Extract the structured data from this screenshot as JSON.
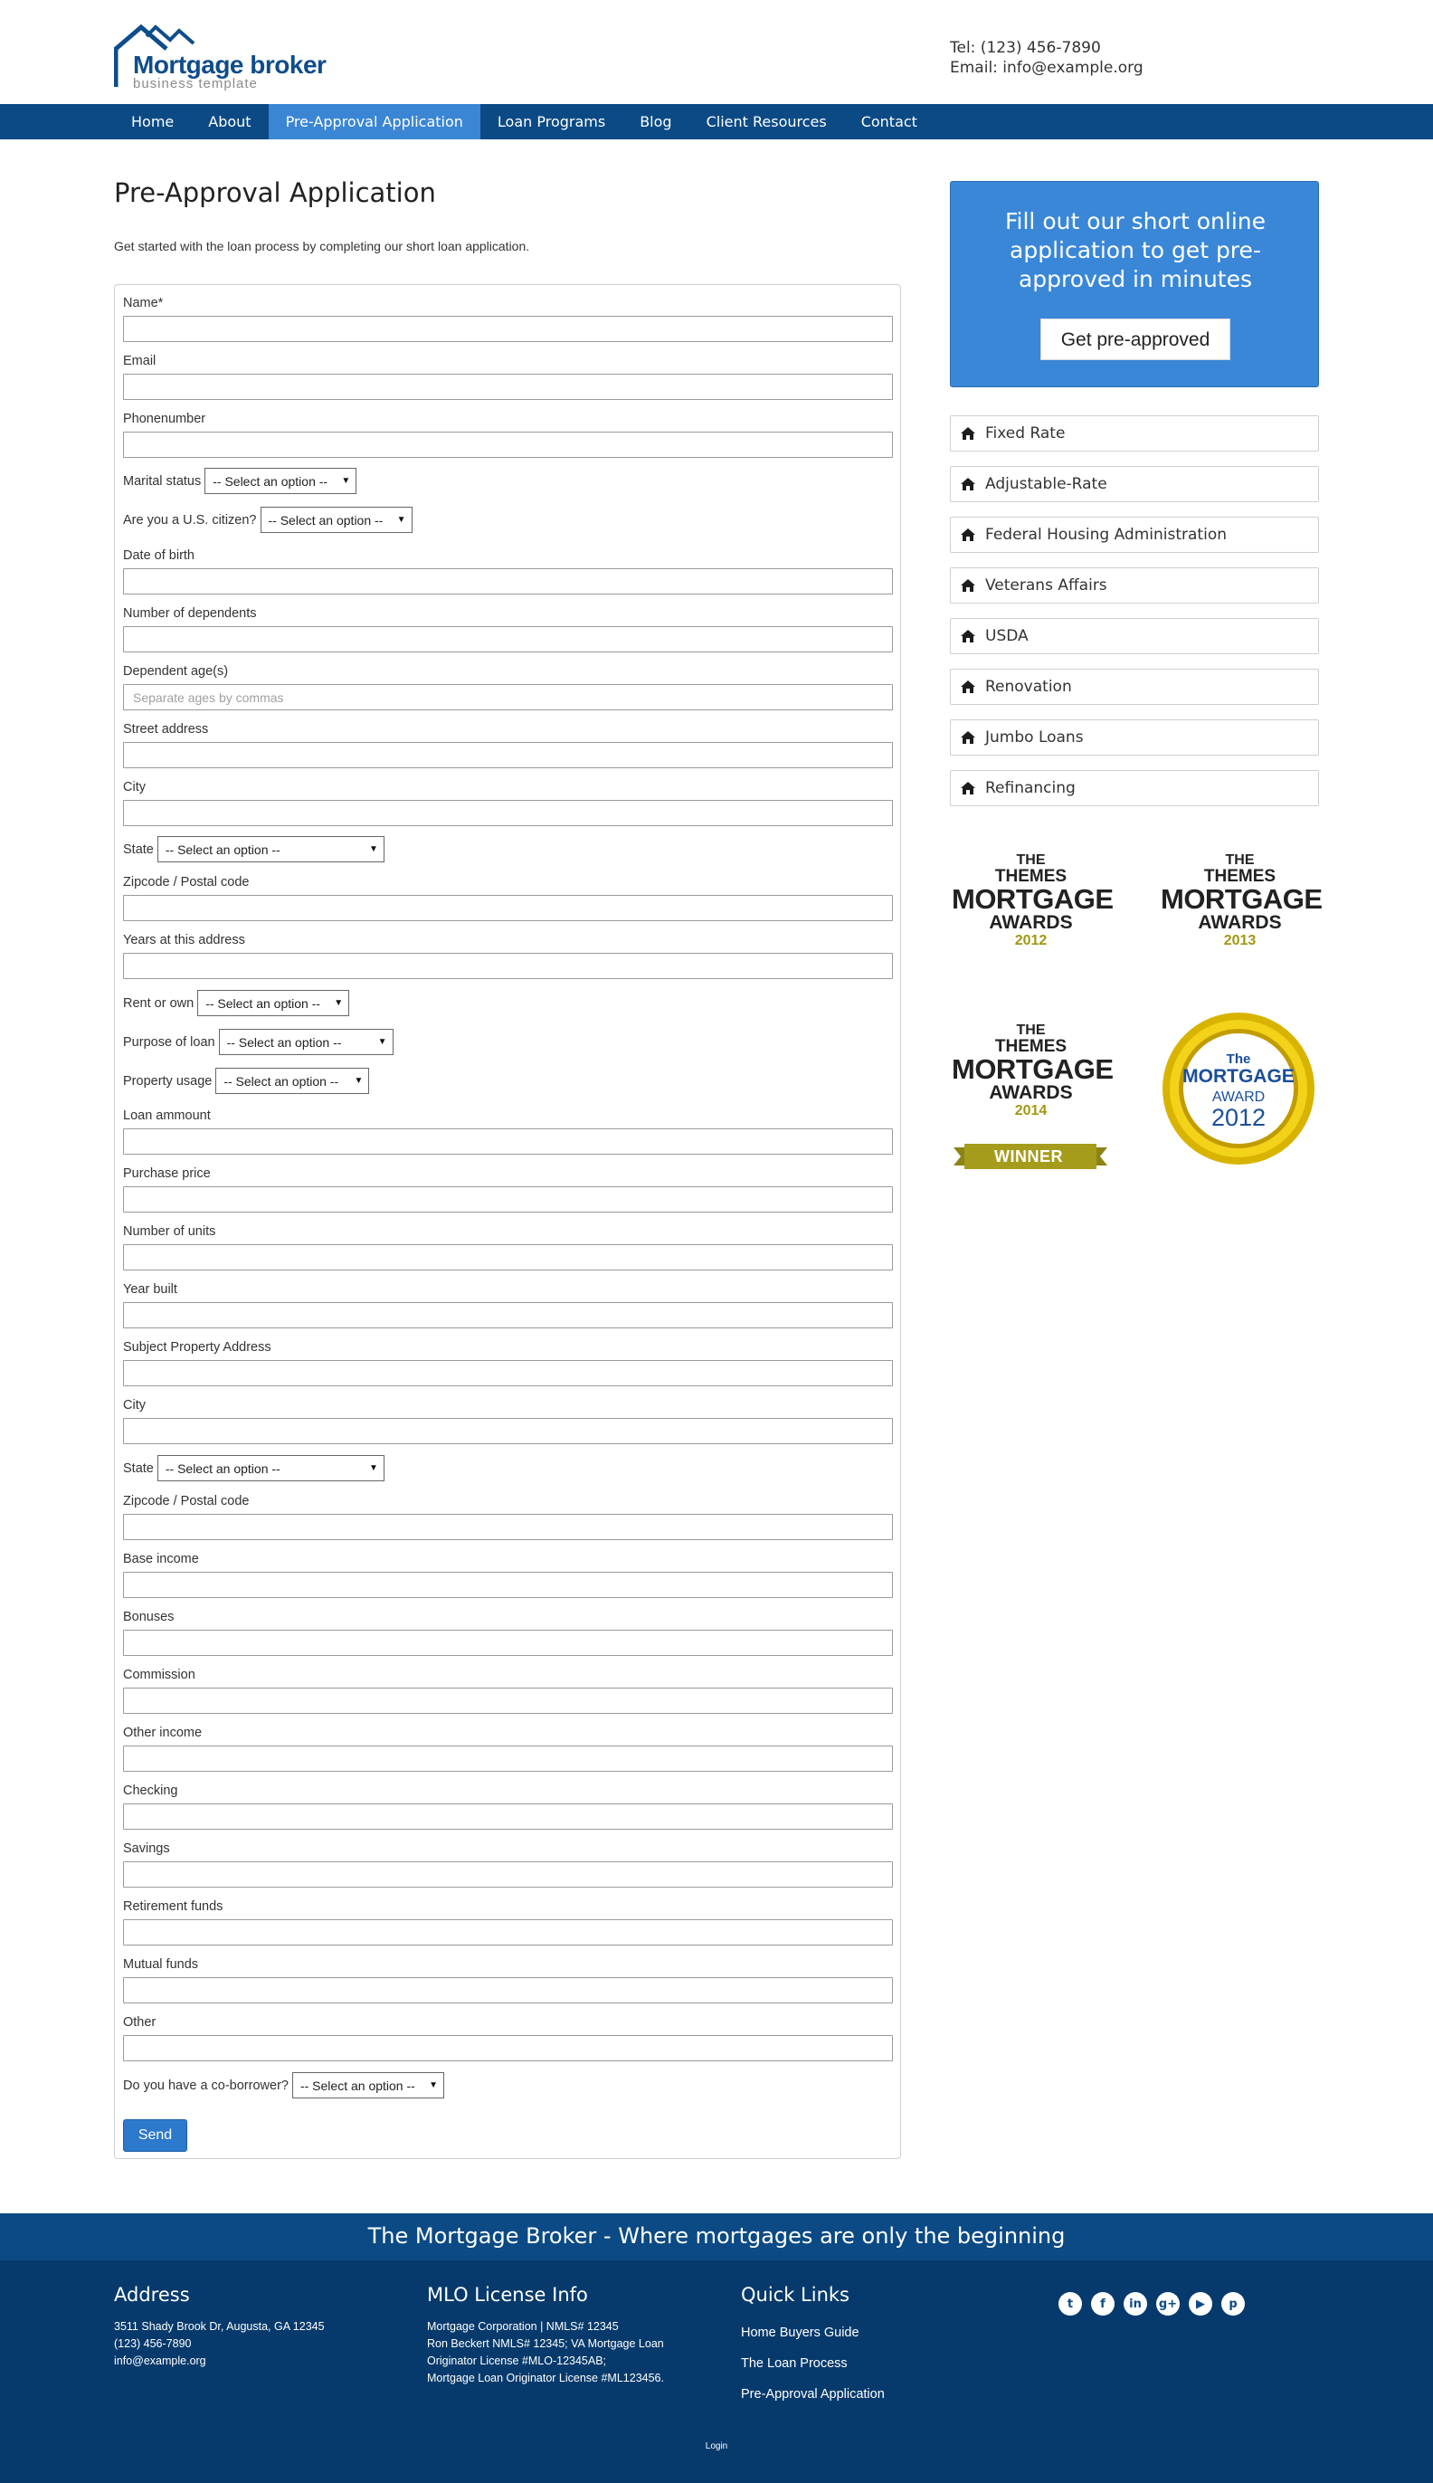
{
  "header": {
    "logo_name": "Mortgage broker",
    "logo_tagline": "business template",
    "tel": "Tel: (123) 456-7890",
    "email": "Email: info@example.org"
  },
  "nav": {
    "items": [
      "Home",
      "About",
      "Pre-Approval Application",
      "Loan Programs",
      "Blog",
      "Client Resources",
      "Contact"
    ],
    "active": "Pre-Approval Application"
  },
  "main": {
    "title": "Pre-Approval Application",
    "intro": "Get started with the loan process by completing our short loan application."
  },
  "form": {
    "select_placeholder": "-- Select an option --",
    "dependent_ages_placeholder": "Separate ages by commas",
    "labels": {
      "name": "Name*",
      "email": "Email",
      "phone": "Phonenumber",
      "marital": "Marital status",
      "citizen": "Are you a U.S. citizen?",
      "dob": "Date of birth",
      "dependents": "Number of dependents",
      "dependent_ages": "Dependent age(s)",
      "street": "Street address",
      "city": "City",
      "state": "State",
      "zip": "Zipcode / Postal code",
      "years": "Years at this address",
      "rent_own": "Rent or own",
      "purpose": "Purpose of loan",
      "usage": "Property usage",
      "loan_amount": "Loan ammount",
      "purchase_price": "Purchase price",
      "units": "Number of units",
      "year_built": "Year built",
      "subject_address": "Subject Property Address",
      "city2": "City",
      "state2": "State",
      "zip2": "Zipcode / Postal code",
      "base_income": "Base income",
      "bonuses": "Bonuses",
      "commission": "Commission",
      "other_income": "Other income",
      "checking": "Checking",
      "savings": "Savings",
      "retirement": "Retirement funds",
      "mutual": "Mutual funds",
      "other": "Other",
      "coborrower": "Do you have a co-borrower?"
    },
    "send_label": "Send"
  },
  "sidebar": {
    "cta_text": "Fill out our short online application to get pre-approved in minutes",
    "cta_button": "Get pre-approved",
    "loan_programs": [
      "Fixed Rate",
      "Adjustable-Rate",
      "Federal Housing Administration",
      "Veterans Affairs",
      "USDA",
      "Renovation",
      "Jumbo Loans",
      "Refinancing"
    ],
    "awards": [
      {
        "the": "THE",
        "themes": "THEMES",
        "mortgage": "MORTGAGE",
        "awards": "AWARDS",
        "year": "2012"
      },
      {
        "the": "THE",
        "themes": "THEMES",
        "mortgage": "MORTGAGE",
        "awards": "AWARDS",
        "year": "2013"
      },
      {
        "the": "THE",
        "themes": "THEMES",
        "mortgage": "MORTGAGE",
        "awards": "AWARDS",
        "year": "2014",
        "ribbon": "WINNER"
      }
    ],
    "badge": {
      "the": "The",
      "mortgage": "MORTGAGE",
      "award": "AWARD",
      "year": "2012"
    }
  },
  "footer": {
    "tagline": "The Mortgage Broker - Where mortgages are only the beginning",
    "address": {
      "heading": "Address",
      "line1": "3511 Shady Brook Dr, Augusta, GA 12345",
      "line2": "(123) 456-7890",
      "line3": "info@example.org"
    },
    "mlo": {
      "heading": "MLO License Info",
      "line1": "Mortgage Corporation | NMLS# 12345",
      "line2": "Ron Beckert NMLS# 12345; VA Mortgage Loan",
      "line3": "Originator License #MLO-12345AB;",
      "line4": "Mortgage Loan Originator License #ML123456."
    },
    "quick_links": {
      "heading": "Quick Links",
      "links": [
        "Home Buyers Guide",
        "The Loan Process",
        "Pre-Approval Application"
      ]
    },
    "social_icons": [
      "twitter-icon",
      "facebook-icon",
      "linkedin-icon",
      "google-plus-icon",
      "youtube-icon",
      "pinterest-icon"
    ],
    "login": "Login"
  },
  "colors": {
    "nav_bg": "#0b4a85",
    "nav_active": "#3a86d4",
    "cta_bg": "#3a87d8",
    "footer_bg": "#073a6c",
    "award_gold": "#a39714"
  }
}
